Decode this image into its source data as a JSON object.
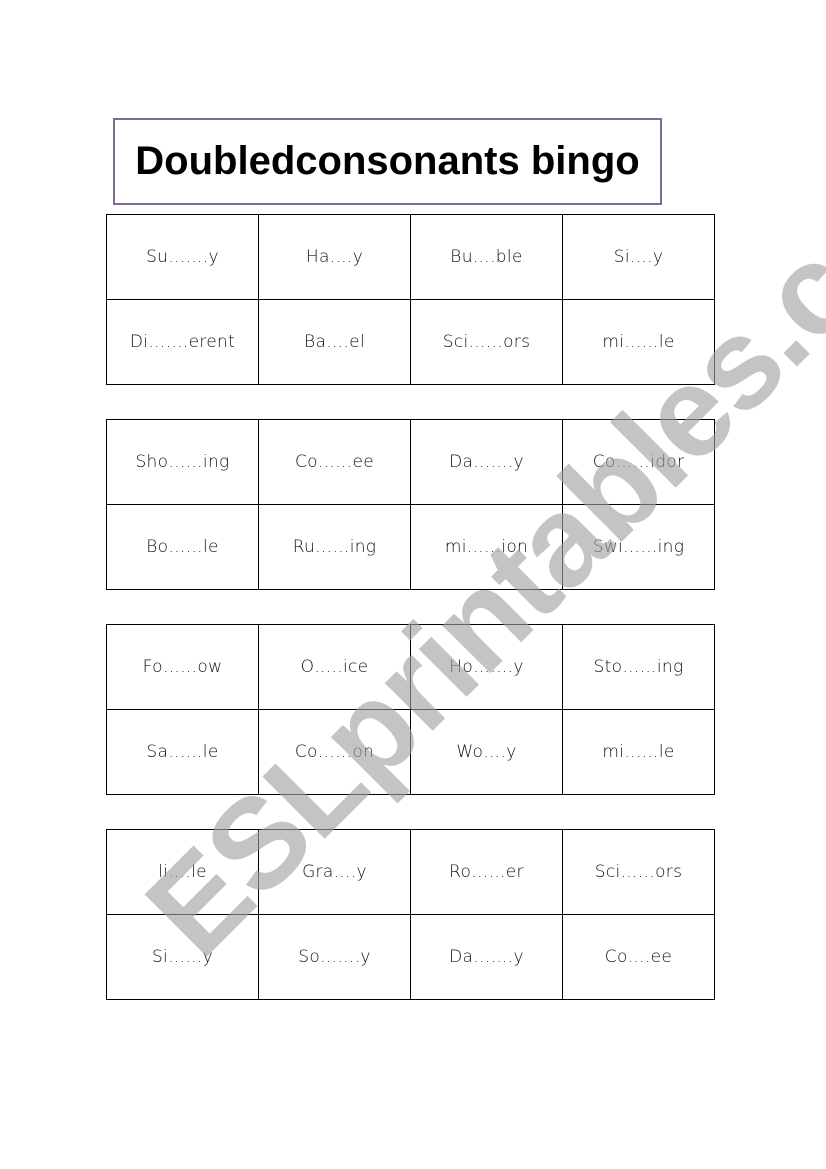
{
  "document": {
    "title": "Doubledconsonants bingo",
    "colors": {
      "title_border": "#7f6b95",
      "watermark": "#a0a0a0",
      "grid_border": "#000000"
    }
  },
  "bingo_cards": [
    {
      "rows": [
        [
          "Su…….y",
          "Ha….y",
          "Bu….ble",
          "Si….y"
        ],
        [
          "Di…….erent",
          "Ba….el",
          "Sci……ors",
          "mi……le"
        ]
      ]
    },
    {
      "rows": [
        [
          "Sho……ing",
          "Co……ee",
          "Da…….y",
          "Co……idor"
        ],
        [
          "Bo……le",
          "Ru……ing",
          "mi……ion",
          "Swi……ing"
        ]
      ]
    },
    {
      "rows": [
        [
          "Fo……ow",
          "O…..ice",
          "Ho…….y",
          "Sto……ing"
        ],
        [
          "Sa……le",
          "Co……on",
          "Wo….y",
          "mi……le"
        ]
      ]
    },
    {
      "rows": [
        [
          "li….le",
          "Gra….y",
          "Ro……er",
          "Sci……ors"
        ],
        [
          "Si……y",
          "So…….y",
          "Da…….y",
          "Co….ee"
        ]
      ]
    }
  ],
  "watermark": {
    "text": "ESLprintables.com"
  }
}
